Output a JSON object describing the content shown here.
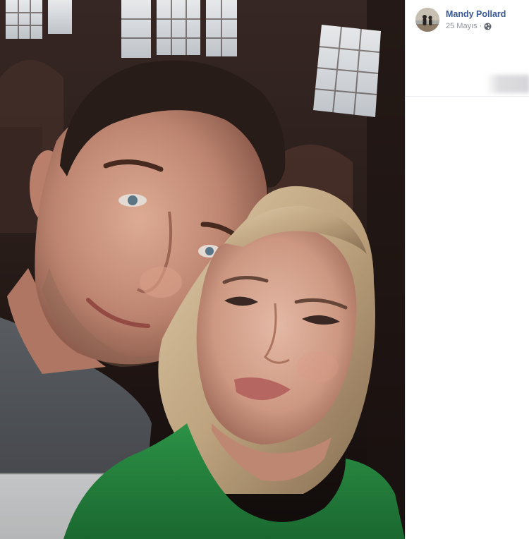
{
  "post": {
    "author_name": "Mandy Pollard",
    "date": "25 Mayıs",
    "separator": "·",
    "audience_icon": "globe-icon"
  },
  "photo": {
    "subject": "selfie-photo"
  },
  "colors": {
    "author_link": "#385898",
    "meta_text": "#90949c",
    "panel_border": "#e3e5e8",
    "photo_background": "#1a1210"
  }
}
